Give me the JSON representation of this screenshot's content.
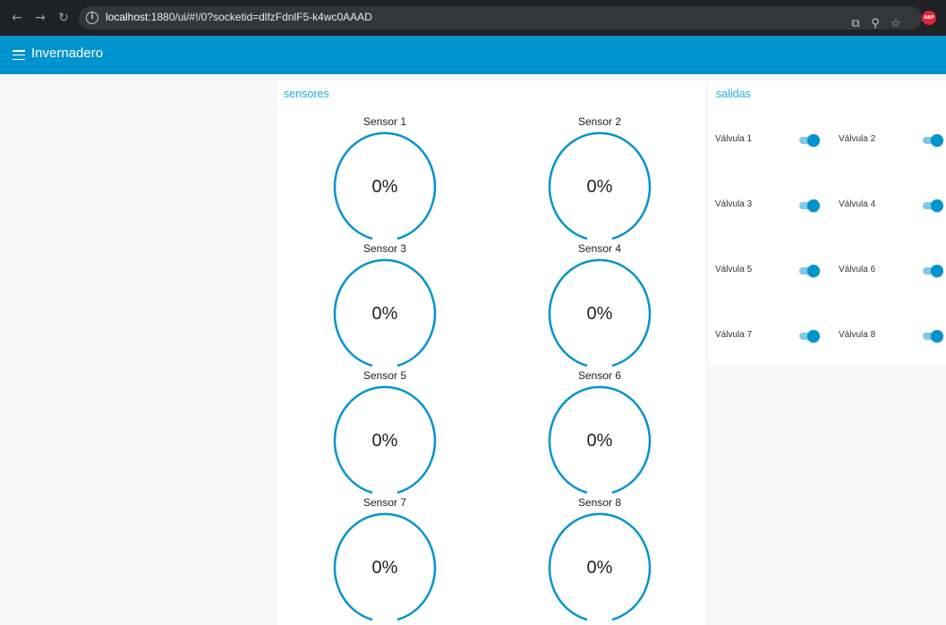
{
  "browser": {
    "url_host": "localhost",
    "url_rest": ":1880/ui/#!/0?socketid=dlfzFdnlF5-k4wc0AAAD",
    "extension_badge": "ABP"
  },
  "header": {
    "title": "Invernadero"
  },
  "sensores": {
    "title": "sensores",
    "gauges": [
      {
        "label": "Sensor 1",
        "value": "0%"
      },
      {
        "label": "Sensor 2",
        "value": "0%"
      },
      {
        "label": "Sensor 3",
        "value": "0%"
      },
      {
        "label": "Sensor 4",
        "value": "0%"
      },
      {
        "label": "Sensor 5",
        "value": "0%"
      },
      {
        "label": "Sensor 6",
        "value": "0%"
      },
      {
        "label": "Sensor 7",
        "value": "0%"
      },
      {
        "label": "Sensor 8",
        "value": "0%"
      }
    ]
  },
  "salidas": {
    "title": "salidas",
    "switches": [
      {
        "label": "Válvula 1",
        "on": true
      },
      {
        "label": "Válvula 2",
        "on": true
      },
      {
        "label": "Válvula 3",
        "on": true
      },
      {
        "label": "Válvula 4",
        "on": true
      },
      {
        "label": "Válvula 5",
        "on": true
      },
      {
        "label": "Válvula 6",
        "on": true
      },
      {
        "label": "Válvula 7",
        "on": true
      },
      {
        "label": "Válvula 8",
        "on": true
      }
    ]
  },
  "colors": {
    "accent": "#0094ce",
    "group_title": "#1bb0e6",
    "browser_bar": "#202124"
  }
}
